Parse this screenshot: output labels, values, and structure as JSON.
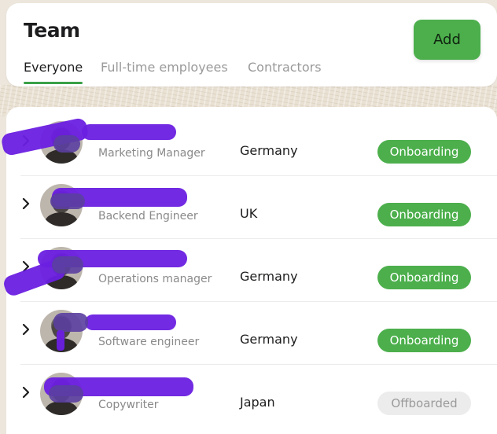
{
  "header": {
    "title": "Team",
    "add_label": "Add",
    "tabs": [
      {
        "label": "Everyone",
        "active": true
      },
      {
        "label": "Full-time employees",
        "active": false
      },
      {
        "label": "Contractors",
        "active": false
      }
    ]
  },
  "members": [
    {
      "role": "Marketing Manager",
      "country": "Germany",
      "status": "Onboarding",
      "status_kind": "onboarding"
    },
    {
      "role": "Backend Engineer",
      "country": "UK",
      "status": "Onboarding",
      "status_kind": "onboarding"
    },
    {
      "role": "Operations manager",
      "country": "Germany",
      "status": "Onboarding",
      "status_kind": "onboarding"
    },
    {
      "role": "Software engineer",
      "country": "Germany",
      "status": "Onboarding",
      "status_kind": "onboarding"
    },
    {
      "role": "Copywriter",
      "country": "Japan",
      "status": "Offboarded",
      "status_kind": "offboarded"
    }
  ],
  "icons": {
    "chevron": "chevron-right-icon",
    "avatar": "avatar"
  },
  "colors": {
    "accent_green": "#4caf4c",
    "tab_underline": "#3aa048",
    "offboarded_bg": "#ececec",
    "redaction": "#6a1fe0"
  }
}
